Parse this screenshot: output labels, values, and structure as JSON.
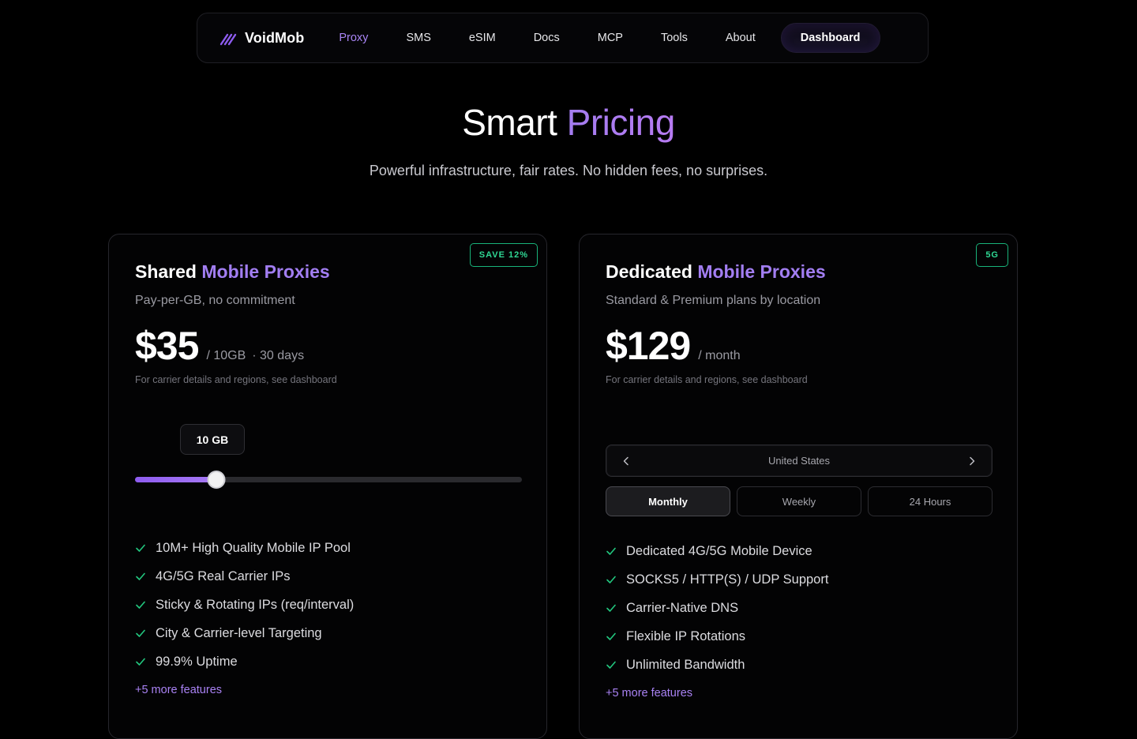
{
  "nav": {
    "brand": "VoidMob",
    "links": [
      "Proxy",
      "SMS",
      "eSIM",
      "Docs",
      "MCP",
      "Tools",
      "About"
    ],
    "active_link": "Proxy",
    "dashboard_label": "Dashboard"
  },
  "hero": {
    "title_plain": "Smart",
    "title_accent": "Pricing",
    "subtitle": "Powerful infrastructure, fair rates. No hidden fees, no surprises."
  },
  "shared": {
    "badge": "SAVE 12%",
    "title_plain": "Shared",
    "title_accent": "Mobile Proxies",
    "subtitle": "Pay-per-GB, no commitment",
    "price": "$35",
    "unit": "/ 10GB",
    "period": "· 30 days",
    "note": "For carrier details and regions, see dashboard",
    "slider": {
      "label": "10 GB",
      "fraction": 0.21
    },
    "features": [
      "10M+ High Quality Mobile IP Pool",
      "4G/5G Real Carrier IPs",
      "Sticky & Rotating IPs (req/interval)",
      "City & Carrier-level Targeting",
      "99.9% Uptime"
    ],
    "more": "+5 more features"
  },
  "dedicated": {
    "badge": "5G",
    "title_plain": "Dedicated",
    "title_accent": "Mobile Proxies",
    "subtitle": "Standard & Premium plans by location",
    "price": "$129",
    "unit": "/ month",
    "note": "For carrier details and regions, see dashboard",
    "location": "United States",
    "periods": [
      "Monthly",
      "Weekly",
      "24 Hours"
    ],
    "active_period": "Monthly",
    "features": [
      "Dedicated 4G/5G Mobile Device",
      "SOCKS5 / HTTP(S) / UDP Support",
      "Carrier-Native DNS",
      "Flexible IP Rotations",
      "Unlimited Bandwidth"
    ],
    "more": "+5 more features"
  },
  "colors": {
    "accent": "#a27ef2",
    "check": "#22c77f",
    "badge": "#19b37a"
  }
}
